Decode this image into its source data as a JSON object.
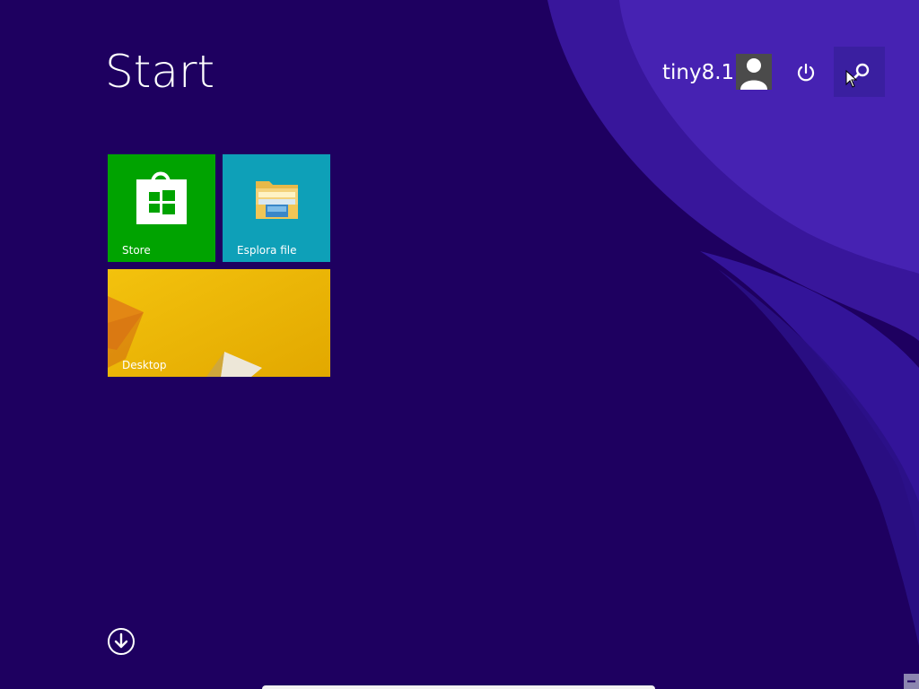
{
  "screen": {
    "title": "Start",
    "background_color": "#1e0060",
    "accent_color": "#3a1fa0"
  },
  "user": {
    "name": "tiny8.1",
    "avatar_icon": "user-silhouette-icon"
  },
  "header_buttons": {
    "power_icon": "power-icon",
    "search_icon": "search-icon"
  },
  "tiles": [
    {
      "label": "Store",
      "color": "#00a300",
      "icon": "store-bag-icon"
    },
    {
      "label": "Esplora file",
      "color": "#0ea0b8",
      "icon": "folder-icon"
    },
    {
      "label": "Desktop",
      "color": "#e5b200",
      "icon": "desktop-wallpaper"
    }
  ],
  "footer": {
    "all_apps_icon": "down-arrow-circle-icon"
  }
}
